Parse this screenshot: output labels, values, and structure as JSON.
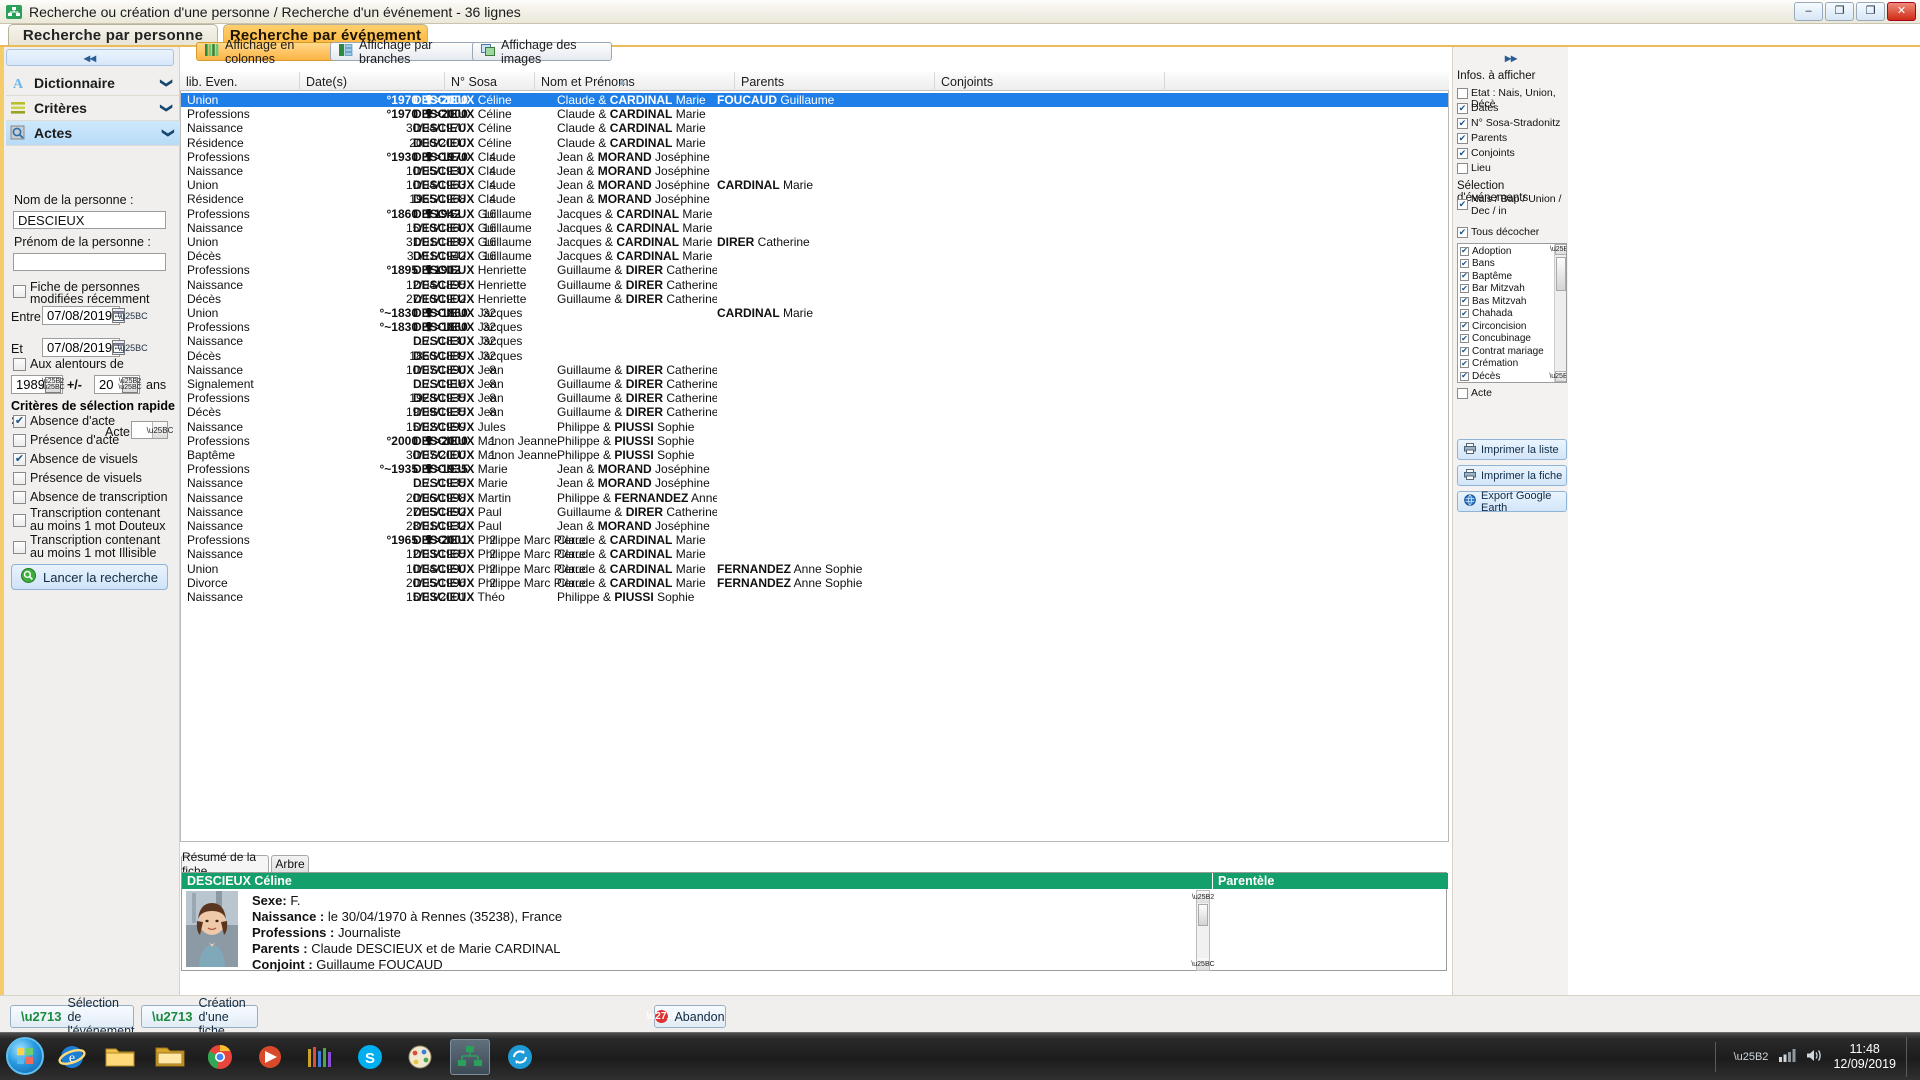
{
  "window": {
    "title": "Recherche ou création d'une personne / Recherche d'un événement - 36 lignes",
    "app_icon": "tree-icon",
    "minimize": "–",
    "maximize": "❐",
    "restore": "❐",
    "close": "✕"
  },
  "main_tabs": [
    {
      "label": "Recherche par personne",
      "active": false
    },
    {
      "label": "Recherche par événement",
      "active": true
    }
  ],
  "view_buttons": [
    {
      "label": "Affichage en colonnes",
      "icon": "columns-icon",
      "active": true
    },
    {
      "label": "Affichage par branches",
      "icon": "branches-icon",
      "active": false
    },
    {
      "label": "Affichage des images",
      "icon": "images-icon",
      "active": false
    }
  ],
  "left_panel": {
    "collapse_glyph": "◂◂",
    "accordions": [
      {
        "label": "Dictionnaire",
        "icon": "letter-a-icon",
        "selected": false,
        "chevron": "❯"
      },
      {
        "label": "Critères",
        "icon": "lines-icon",
        "selected": false,
        "chevron": "❯"
      },
      {
        "label": "Actes",
        "icon": "magnifier-icon",
        "selected": true,
        "chevron": "❮"
      }
    ],
    "nom_label": "Nom de la personne :",
    "nom_value": "DESCIEUX",
    "prenom_label": "Prénom de la personne :",
    "prenom_value": "",
    "recent_checkbox": {
      "label": "Fiche de personnes modifiées récemment",
      "checked": false
    },
    "entre_label": "Entre",
    "entre_value": "07/08/2019",
    "et_label": "Et",
    "et_value": "07/08/2019",
    "alentours_checkbox": {
      "label": "Aux alentours de",
      "checked": false
    },
    "year_value": "1989",
    "plus_minus": "+/-",
    "range_value": "20",
    "ans_label": "ans",
    "quick_title": "Critères de sélection rapide :",
    "quick_items": [
      {
        "label": "Absence d'acte",
        "checked": true
      },
      {
        "label": "Présence d'acte",
        "checked": false
      },
      {
        "label": "Absence de visuels",
        "checked": true
      },
      {
        "label": "Présence de visuels",
        "checked": false
      },
      {
        "label": "Absence de transcription",
        "checked": false
      },
      {
        "label": "Transcription contenant au moins 1 mot  Douteux",
        "checked": false
      },
      {
        "label": "Transcription contenant au moins 1 mot Illisible",
        "checked": false
      }
    ],
    "acte_label": "Acte",
    "acte_value": "",
    "search_button": {
      "label": "Lancer la recherche",
      "icon": "search-run-icon"
    }
  },
  "table": {
    "columns": [
      {
        "key": "even",
        "label": "lib. Even."
      },
      {
        "key": "dates",
        "label": "Date(s)"
      },
      {
        "key": "sosa",
        "label": "N° Sosa"
      },
      {
        "key": "nom",
        "label": "Nom et Prénoms"
      },
      {
        "key": "parents",
        "label": "Parents"
      },
      {
        "key": "conjoints",
        "label": "Conjoints"
      }
    ],
    "sort_indicator": "▲",
    "sort_column": "Nom et Prénoms",
    "rows": [
      {
        "even": "Union",
        "birth": "°1970",
        "death": "✟>2000",
        "date": "",
        "sosa": "",
        "nom_b": "DESCIEUX",
        "nom_p": "Céline",
        "par_a": "Claude &",
        "par_b": "CARDINAL",
        "par_c": "Marie",
        "conj_b": "FOUCAUD",
        "conj_p": "Guillaume",
        "selected": true
      },
      {
        "even": "Professions",
        "birth": "°1970",
        "death": "✟>2000",
        "date": "",
        "sosa": "",
        "nom_b": "DESCIEUX",
        "nom_p": "Céline",
        "par_a": "Claude &",
        "par_b": "CARDINAL",
        "par_c": "Marie",
        "conj_b": "",
        "conj_p": "",
        "selected": false
      },
      {
        "even": "Naissance",
        "birth": "",
        "death": "",
        "date": "30/04/1970",
        "sosa": "",
        "nom_b": "DESCIEUX",
        "nom_p": "Céline",
        "par_a": "Claude &",
        "par_b": "CARDINAL",
        "par_c": "Marie",
        "conj_b": "",
        "conj_p": "",
        "selected": false
      },
      {
        "even": "Résidence",
        "birth": "",
        "death": "",
        "date": "2000/2000",
        "sosa": "",
        "nom_b": "DESCIEUX",
        "nom_p": "Céline",
        "par_a": "Claude &",
        "par_b": "CARDINAL",
        "par_c": "Marie",
        "conj_b": "",
        "conj_p": "",
        "selected": false
      },
      {
        "even": "Professions",
        "birth": "°1930",
        "death": "✟>1970",
        "date": "",
        "sosa": "4",
        "nom_b": "DESCIEUX",
        "nom_p": "Claude",
        "par_a": "Jean &",
        "par_b": "MORAND",
        "par_c": "Joséphine",
        "conj_b": "",
        "conj_p": "",
        "selected": false
      },
      {
        "even": "Naissance",
        "birth": "",
        "death": "",
        "date": "10/05/1930",
        "sosa": "4",
        "nom_b": "DESCIEUX",
        "nom_p": "Claude",
        "par_a": "Jean &",
        "par_b": "MORAND",
        "par_c": "Joséphine",
        "conj_b": "",
        "conj_p": "",
        "selected": false
      },
      {
        "even": "Union",
        "birth": "",
        "death": "",
        "date": "10/04/1963",
        "sosa": "4",
        "nom_b": "DESCIEUX",
        "nom_p": "Claude",
        "par_a": "Jean &",
        "par_b": "MORAND",
        "par_c": "Joséphine",
        "conj_b": "CARDINAL",
        "conj_p": "Marie",
        "selected": false
      },
      {
        "even": "Résidence",
        "birth": "",
        "death": "",
        "date": "1965/1968",
        "sosa": "4",
        "nom_b": "DESCIEUX",
        "nom_p": "Claude",
        "par_a": "Jean &",
        "par_b": "MORAND",
        "par_c": "Joséphine",
        "conj_b": "",
        "conj_p": "",
        "selected": false
      },
      {
        "even": "Professions",
        "birth": "°1860",
        "death": "✟1942",
        "date": "",
        "sosa": "16",
        "nom_b": "DESCIEUX",
        "nom_p": "Guillaume",
        "par_a": "Jacques &",
        "par_b": "CARDINAL",
        "par_c": "Marie",
        "conj_b": "",
        "conj_p": "",
        "selected": false
      },
      {
        "even": "Naissance",
        "birth": "",
        "death": "",
        "date": "15/10/1860",
        "sosa": "16",
        "nom_b": "DESCIEUX",
        "nom_p": "Guillaume",
        "par_a": "Jacques &",
        "par_b": "CARDINAL",
        "par_c": "Marie",
        "conj_b": "",
        "conj_p": "",
        "selected": false
      },
      {
        "even": "Union",
        "birth": "",
        "death": "",
        "date": "31/01/1889",
        "sosa": "16",
        "nom_b": "DESCIEUX",
        "nom_p": "Guillaume",
        "par_a": "Jacques &",
        "par_b": "CARDINAL",
        "par_c": "Marie",
        "conj_b": "DIRER",
        "conj_p": "Catherine",
        "selected": false
      },
      {
        "even": "Décès",
        "birth": "",
        "death": "",
        "date": "30/11/1942",
        "sosa": "16",
        "nom_b": "DESCIEUX",
        "nom_p": "Guillaume",
        "par_a": "Jacques &",
        "par_b": "CARDINAL",
        "par_c": "Marie",
        "conj_b": "",
        "conj_p": "",
        "selected": false
      },
      {
        "even": "Professions",
        "birth": "°1895",
        "death": "✟1902",
        "date": "",
        "sosa": "",
        "nom_b": "DESCIEUX",
        "nom_p": "Henriette",
        "par_a": "Guillaume &",
        "par_b": "DIRER",
        "par_c": "Catherine",
        "conj_b": "",
        "conj_p": "",
        "selected": false
      },
      {
        "even": "Naissance",
        "birth": "",
        "death": "",
        "date": "12/04/1895",
        "sosa": "",
        "nom_b": "DESCIEUX",
        "nom_p": "Henriette",
        "par_a": "Guillaume &",
        "par_b": "DIRER",
        "par_c": "Catherine",
        "conj_b": "",
        "conj_p": "",
        "selected": false
      },
      {
        "even": "Décès",
        "birth": "",
        "death": "",
        "date": "27/10/1902",
        "sosa": "",
        "nom_b": "DESCIEUX",
        "nom_p": "Henriette",
        "par_a": "Guillaume &",
        "par_b": "DIRER",
        "par_c": "Catherine",
        "conj_b": "",
        "conj_p": "",
        "selected": false
      },
      {
        "even": "Union",
        "birth": "°~1830",
        "death": "✟>1860",
        "date": "",
        "sosa": "32",
        "nom_b": "DESCIEUX",
        "nom_p": "Jacques",
        "par_a": "",
        "par_b": "",
        "par_c": "",
        "conj_b": "CARDINAL",
        "conj_p": "Marie",
        "selected": false
      },
      {
        "even": "Professions",
        "birth": "°~1830",
        "death": "✟>1860",
        "date": "",
        "sosa": "32",
        "nom_b": "DESCIEUX",
        "nom_p": "Jacques",
        "par_a": "",
        "par_b": "",
        "par_c": "",
        "conj_b": "",
        "conj_p": "",
        "selected": false
      },
      {
        "even": "Naissance",
        "birth": "",
        "death": "",
        "date": "../../1830",
        "sosa": "32",
        "nom_b": "DESCIEUX",
        "nom_p": "Jacques",
        "par_a": "",
        "par_b": "",
        "par_c": "",
        "conj_b": "",
        "conj_p": "",
        "selected": false
      },
      {
        "even": "Décès",
        "birth": "",
        "death": "",
        "date": "1860/1889",
        "sosa": "32",
        "nom_b": "DESCIEUX",
        "nom_p": "Jacques",
        "par_a": "",
        "par_b": "",
        "par_c": "",
        "conj_b": "",
        "conj_p": "",
        "selected": false
      },
      {
        "even": "Naissance",
        "birth": "",
        "death": "",
        "date": "10/07/1890",
        "sosa": "8",
        "nom_b": "DESCIEUX",
        "nom_p": "Jean",
        "par_a": "Guillaume &",
        "par_b": "DIRER",
        "par_c": "Catherine",
        "conj_b": "",
        "conj_p": "",
        "selected": false
      },
      {
        "even": "Signalement",
        "birth": "",
        "death": "",
        "date": "../../1916",
        "sosa": "8",
        "nom_b": "DESCIEUX",
        "nom_p": "Jean",
        "par_a": "Guillaume &",
        "par_b": "DIRER",
        "par_c": "Catherine",
        "conj_b": "",
        "conj_p": "",
        "selected": false
      },
      {
        "even": "Professions",
        "birth": "",
        "death": "",
        "date": "1928/1935",
        "sosa": "8",
        "nom_b": "DESCIEUX",
        "nom_p": "Jean",
        "par_a": "Guillaume &",
        "par_b": "DIRER",
        "par_c": "Catherine",
        "conj_b": "",
        "conj_p": "",
        "selected": false
      },
      {
        "even": "Décès",
        "birth": "",
        "death": "",
        "date": "19/09/1935",
        "sosa": "8",
        "nom_b": "DESCIEUX",
        "nom_p": "Jean",
        "par_a": "Guillaume &",
        "par_b": "DIRER",
        "par_c": "Catherine",
        "conj_b": "",
        "conj_p": "",
        "selected": false
      },
      {
        "even": "Naissance",
        "birth": "",
        "death": "",
        "date": "15/02/1999",
        "sosa": "",
        "nom_b": "DESCIEUX",
        "nom_p": "Jules",
        "par_a": "Philippe &",
        "par_b": "PIUSSI",
        "par_c": "Sophie",
        "conj_b": "",
        "conj_p": "",
        "selected": false
      },
      {
        "even": "Professions",
        "birth": "°2000",
        "death": "✟>2000",
        "date": "",
        "sosa": "1",
        "nom_b": "DESCIEUX",
        "nom_p": "Manon Jeanne",
        "par_a": "Philippe &",
        "par_b": "PIUSSI",
        "par_c": "Sophie",
        "conj_b": "",
        "conj_p": "",
        "selected": false
      },
      {
        "even": "Baptême",
        "birth": "",
        "death": "",
        "date": "30/07/2000",
        "sosa": "1",
        "nom_b": "DESCIEUX",
        "nom_p": "Manon Jeanne",
        "par_a": "Philippe &",
        "par_b": "PIUSSI",
        "par_c": "Sophie",
        "conj_b": "",
        "conj_p": "",
        "selected": false
      },
      {
        "even": "Professions",
        "birth": "°~1935",
        "death": "✟>1935",
        "date": "",
        "sosa": "",
        "nom_b": "DESCIEUX",
        "nom_p": "Marie",
        "par_a": "Jean &",
        "par_b": "MORAND",
        "par_c": "Joséphine",
        "conj_b": "",
        "conj_p": "",
        "selected": false
      },
      {
        "even": "Naissance",
        "birth": "",
        "death": "",
        "date": "../../1935",
        "sosa": "",
        "nom_b": "DESCIEUX",
        "nom_p": "Marie",
        "par_a": "Jean &",
        "par_b": "MORAND",
        "par_c": "Joséphine",
        "conj_b": "",
        "conj_p": "",
        "selected": false
      },
      {
        "even": "Naissance",
        "birth": "",
        "death": "",
        "date": "20/06/1998",
        "sosa": "",
        "nom_b": "DESCIEUX",
        "nom_p": "Martin",
        "par_a": "Philippe &",
        "par_b": "FERNANDEZ",
        "par_c": "Anne",
        "conj_b": "",
        "conj_p": "",
        "selected": false
      },
      {
        "even": "Naissance",
        "birth": "",
        "death": "",
        "date": "27/05/1892",
        "sosa": "",
        "nom_b": "DESCIEUX",
        "nom_p": "Paul",
        "par_a": "Guillaume &",
        "par_b": "DIRER",
        "par_c": "Catherine",
        "conj_b": "",
        "conj_p": "",
        "selected": false
      },
      {
        "even": "Naissance",
        "birth": "",
        "death": "",
        "date": "28/01/1932",
        "sosa": "",
        "nom_b": "DESCIEUX",
        "nom_p": "Paul",
        "par_a": "Jean &",
        "par_b": "MORAND",
        "par_c": "Joséphine",
        "conj_b": "",
        "conj_p": "",
        "selected": false
      },
      {
        "even": "Professions",
        "birth": "°1965",
        "death": "✟>2001",
        "date": "",
        "sosa": "2",
        "nom_b": "DESCIEUX",
        "nom_p": "Philippe Marc Pierre",
        "par_a": "Claude &",
        "par_b": "CARDINAL",
        "par_c": "Marie",
        "conj_b": "",
        "conj_p": "",
        "selected": false
      },
      {
        "even": "Naissance",
        "birth": "",
        "death": "",
        "date": "12/03/1965",
        "sosa": "2",
        "nom_b": "DESCIEUX",
        "nom_p": "Philippe Marc Pierre",
        "par_a": "Claude &",
        "par_b": "CARDINAL",
        "par_c": "Marie",
        "conj_b": "",
        "conj_p": "",
        "selected": false
      },
      {
        "even": "Union",
        "birth": "",
        "death": "",
        "date": "10/04/1990",
        "sosa": "2",
        "nom_b": "DESCIEUX",
        "nom_p": "Philippe Marc Pierre",
        "par_a": "Claude &",
        "par_b": "CARDINAL",
        "par_c": "Marie",
        "conj_b": "FERNANDEZ",
        "conj_p": "Anne Sophie",
        "selected": false
      },
      {
        "even": "Divorce",
        "birth": "",
        "death": "",
        "date": "20/05/1996",
        "sosa": "2",
        "nom_b": "DESCIEUX",
        "nom_p": "Philippe Marc Pierre",
        "par_a": "Claude &",
        "par_b": "CARDINAL",
        "par_c": "Marie",
        "conj_b": "FERNANDEZ",
        "conj_p": "Anne Sophie",
        "selected": false
      },
      {
        "even": "Naissance",
        "birth": "",
        "death": "",
        "date": "15/03/2001",
        "sosa": "",
        "nom_b": "DESCIEUX",
        "nom_p": "Théo",
        "par_a": "Philippe &",
        "par_b": "PIUSSI",
        "par_c": "Sophie",
        "conj_b": "",
        "conj_p": "",
        "selected": false
      }
    ]
  },
  "right_panel": {
    "collapse_glyph": "▸▸",
    "title": "Infos. à afficher",
    "info_items": [
      {
        "label": "Etat : Nais, Union, Décè",
        "checked": false
      },
      {
        "label": "Dates",
        "checked": true
      },
      {
        "label": "N° Sosa-Stradonitz",
        "checked": true
      },
      {
        "label": "Parents",
        "checked": true
      },
      {
        "label": "Conjoints",
        "checked": true
      },
      {
        "label": "Lieu",
        "checked": false
      }
    ],
    "events_title": "Sélection d'événements",
    "nais_item": {
      "label": "Nais / Bap / Union / Dec / in",
      "checked": true
    },
    "uncheck_all": {
      "label": "Tous décocher",
      "checked": true
    },
    "event_list": [
      {
        "label": "Adoption",
        "checked": true
      },
      {
        "label": "Bans",
        "checked": true
      },
      {
        "label": "Baptême",
        "checked": true
      },
      {
        "label": "Bar Mitzvah",
        "checked": true
      },
      {
        "label": "Bas Mitzvah",
        "checked": true
      },
      {
        "label": "Chahada",
        "checked": true
      },
      {
        "label": "Circoncision",
        "checked": true
      },
      {
        "label": "Concubinage",
        "checked": true
      },
      {
        "label": "Contrat mariage",
        "checked": true
      },
      {
        "label": "Crémation",
        "checked": true
      },
      {
        "label": "Décès",
        "checked": true
      }
    ],
    "acte_item": {
      "label": "Acte",
      "checked": false
    },
    "buttons": [
      {
        "label": "Imprimer la liste",
        "icon": "printer-icon"
      },
      {
        "label": "Imprimer la fiche",
        "icon": "printer-icon"
      },
      {
        "label": "Export Google Earth",
        "icon": "globe-icon"
      }
    ]
  },
  "detail": {
    "tabs": [
      {
        "label": "Résumé de la fiche",
        "active": true
      },
      {
        "label": "Arbre",
        "active": false
      }
    ],
    "header_name": "DESCIEUX Céline",
    "parentele_header": "Parentèle",
    "photo": "person-photo",
    "lines": [
      {
        "label": "Sexe:",
        "value": "F."
      },
      {
        "label": "Naissance :",
        "value": "le 30/04/1970 à Rennes (35238), France"
      },
      {
        "label": "Professions :",
        "value": "Journaliste"
      },
      {
        "label": "Parents :",
        "value": "Claude DESCIEUX et de Marie CARDINAL"
      },
      {
        "label": "Conjoint :",
        "value": "Guillaume FOUCAUD"
      }
    ]
  },
  "footer": {
    "buttons": [
      {
        "label": "Sélection de l'événement",
        "icon": "check-icon"
      },
      {
        "label": "Création d'une fiche",
        "icon": "check-icon"
      }
    ],
    "abandon": {
      "label": "Abandon",
      "icon": "cancel-icon"
    }
  },
  "taskbar": {
    "start": "start-orb",
    "items": [
      "ie-icon",
      "folder-icon",
      "explorer-icon",
      "chrome-icon",
      "media-icon",
      "bars-icon",
      "skype-icon",
      "paint-icon",
      "tree-icon",
      "sync-icon"
    ],
    "time": "11:48",
    "date": "12/09/2019",
    "tray_icons": [
      "chevron-up-icon",
      "network-icon",
      "volume-icon"
    ]
  }
}
